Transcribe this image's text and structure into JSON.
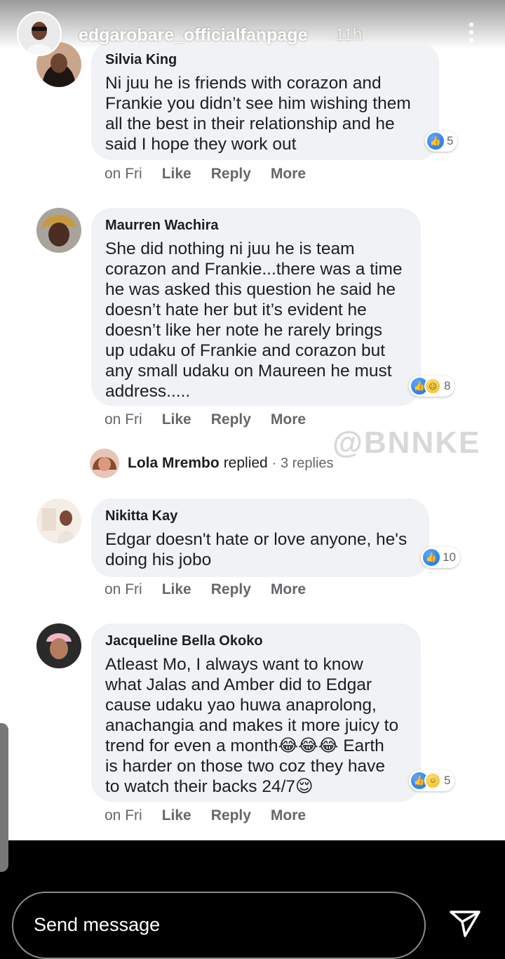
{
  "story": {
    "username": "edgarobare_officialfanpage",
    "time": "11h",
    "watermark": "@BNNKE"
  },
  "comments": [
    {
      "author": "Silvia King",
      "text": "Ni juu he is friends with corazon and\nFrankie you didn’t see him wishing them\nall the best in their relationship and he\nsaid I hope they work out",
      "reaction_count": "5",
      "when": "on Fri",
      "like": "Like",
      "reply": "Reply",
      "more": "More"
    },
    {
      "author": "Maurren Wachira",
      "text": "She did nothing ni juu he is team\ncorazon and Frankie...there was a time\nhe was asked this question he said he\ndoesn’t hate her but it’s evident he\ndoesn’t like her note he rarely brings\nup udaku of Frankie and corazon but\nany small udaku on Maureen he must\naddress.....",
      "reaction_count": "8",
      "when": "on Fri",
      "like": "Like",
      "reply": "Reply",
      "more": "More"
    },
    {
      "author": "Nikitta Kay",
      "text": "Edgar doesn't hate or love anyone, he's\ndoing his jobo",
      "reaction_count": "10",
      "when": "on Fri",
      "like": "Like",
      "reply": "Reply",
      "more": "More"
    },
    {
      "author": "Jacqueline Bella Okoko",
      "text": "Atleast Mo, I always want to know\nwhat Jalas and Amber did to Edgar\ncause udaku yao huwa anaprolong,\nanachangia and makes it more juicy to\ntrend for even a month😂😂😂 Earth\nis harder on those two coz they have\nto watch their backs 24/7😌",
      "reaction_count": "5",
      "when": "on Fri",
      "like": "Like",
      "reply": "Reply",
      "more": "More"
    }
  ],
  "reply_thread": {
    "name": "Lola Mrembo",
    "verb": "replied",
    "count": "· 3 replies"
  },
  "composer": {
    "placeholder": "Send message",
    "send_icon": "send-icon"
  },
  "colors": {
    "bubble": "#f0f2f5",
    "like_blue": "#1771e6",
    "meta_gray": "#65676b"
  }
}
